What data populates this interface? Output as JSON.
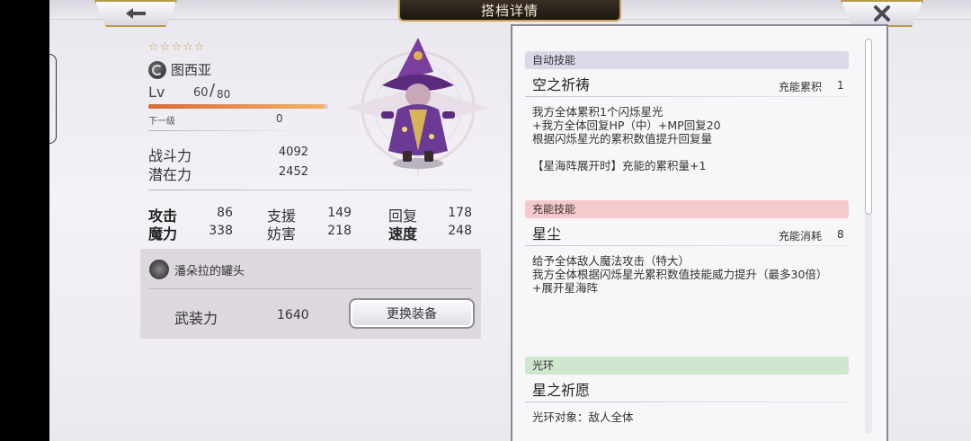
{
  "header": {
    "title": "搭档详情"
  },
  "nav": {
    "back_icon": "arrow-left-icon",
    "close_icon": "close-x-icon"
  },
  "character": {
    "stars": 5,
    "name": "图西亚",
    "lv_label": "Lv",
    "level": "60",
    "max_level": "80",
    "exp_label": "下一级",
    "exp_value": "0",
    "exp_progress": 0.98,
    "combat_label": "战斗力",
    "combat_value": "4092",
    "potential_label": "潜在力",
    "potential_value": "2452"
  },
  "attributes": [
    {
      "label": "攻击",
      "value": "86",
      "bold": true
    },
    {
      "label": "支援",
      "value": "149",
      "bold": false
    },
    {
      "label": "回复",
      "value": "178",
      "bold": false
    },
    {
      "label": "魔力",
      "value": "338",
      "bold": true
    },
    {
      "label": "妨害",
      "value": "218",
      "bold": false
    },
    {
      "label": "速度",
      "value": "248",
      "bold": true
    }
  ],
  "equipment": {
    "name": "潘朵拉的罐头",
    "power_label": "武装力",
    "power_value": "1640",
    "change_button": "更换装备"
  },
  "skills": [
    {
      "category": "自动技能",
      "category_color": "#dcd8ea",
      "name": "空之祈祷",
      "meta_label": "充能累积",
      "meta_value": "1",
      "description": "我方全体累积1个闪烁星光\n+我方全体回复HP（中）+MP回复20\n根据闪烁星光的累积数值提升回复量\n\n【星海阵展开时】充能的累积量+1"
    },
    {
      "category": "充能技能",
      "category_color": "#f6c9cc",
      "name": "星尘",
      "meta_label": "充能消耗",
      "meta_value": "8",
      "description": "给予全体敌人魔法攻击（特大）\n我方全体根据闪烁星光累积数值技能威力提升（最多30倍）\n+展开星海阵"
    },
    {
      "category": "光环",
      "category_color": "#cfe6cf",
      "name": "星之祈愿",
      "meta_label": "",
      "meta_value": "",
      "description": "光环对象：敌人全体"
    }
  ]
}
